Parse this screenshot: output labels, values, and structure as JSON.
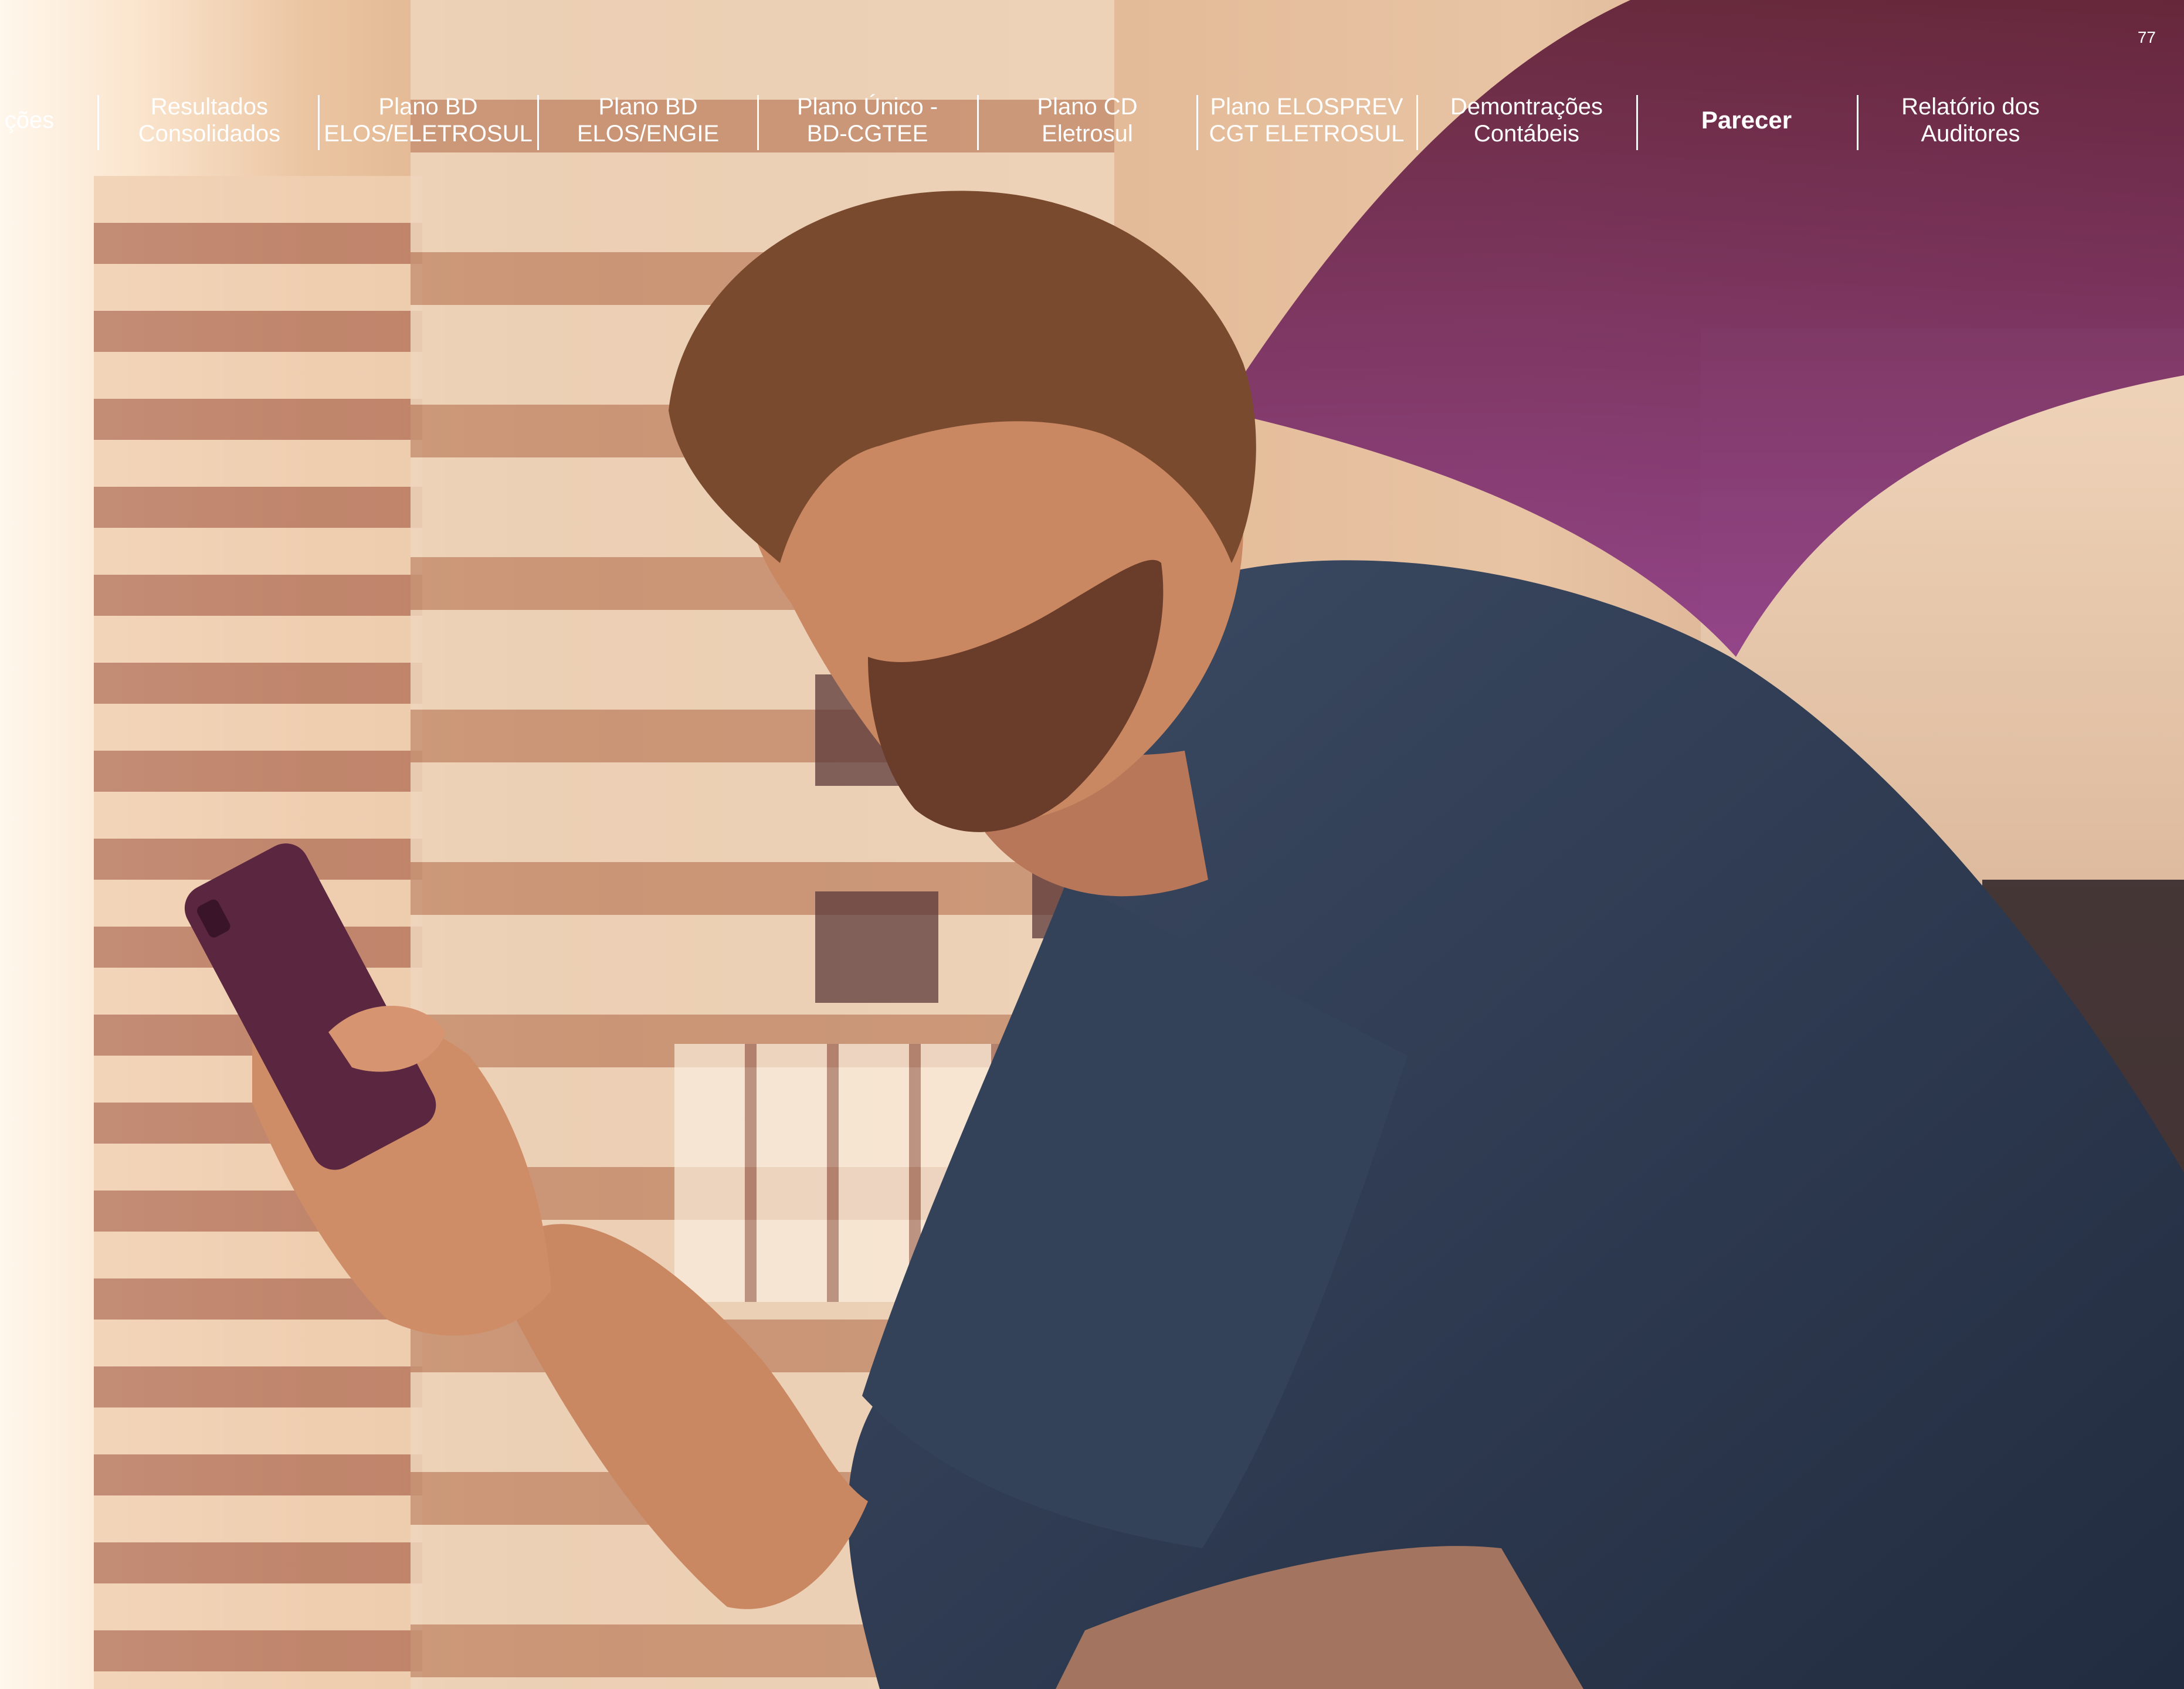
{
  "page_number": "77",
  "nav": {
    "items": [
      {
        "id": "partial",
        "lines": [
          "ções"
        ]
      },
      {
        "id": "resultados",
        "lines": [
          "Resultados",
          "Consolidados"
        ]
      },
      {
        "id": "plano-bd-eletrosul",
        "lines": [
          "Plano BD",
          "ELOS/ELETROSUL"
        ]
      },
      {
        "id": "plano-bd-engie",
        "lines": [
          "Plano BD",
          "ELOS/ENGIE"
        ]
      },
      {
        "id": "plano-unico",
        "lines": [
          "Plano Único -",
          "BD-CGTEE"
        ]
      },
      {
        "id": "plano-cd",
        "lines": [
          "Plano CD",
          "Eletrosul"
        ]
      },
      {
        "id": "plano-elosprev",
        "lines": [
          "Plano ELOSPREV",
          "CGT ELETROSUL"
        ]
      },
      {
        "id": "demonstracoes",
        "lines": [
          "Demontrações",
          "Contábeis"
        ]
      },
      {
        "id": "parecer",
        "lines": [
          "Parecer"
        ],
        "active": true
      },
      {
        "id": "relatorio",
        "lines": [
          "Relatório dos",
          "Auditores"
        ]
      }
    ]
  },
  "colors": {
    "swoosh_top": "#5e1d35",
    "swoosh_bottom": "#8c3a86",
    "shirt": "#2f3d55",
    "phone": "#5a2640",
    "skin": "#c98762",
    "hair": "#7a4a2e"
  }
}
